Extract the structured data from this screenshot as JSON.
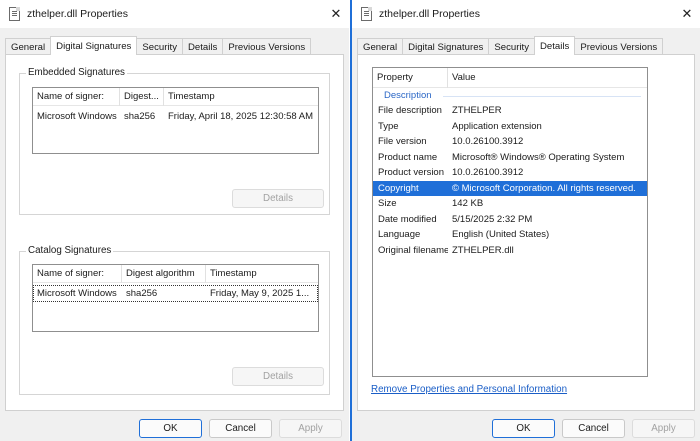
{
  "left_window": {
    "title": "zthelper.dll Properties",
    "close_glyph": "✕",
    "tabs": [
      "General",
      "Digital Signatures",
      "Security",
      "Details",
      "Previous Versions"
    ],
    "active_tab": "Digital Signatures",
    "embedded": {
      "legend": "Embedded Signatures",
      "columns": [
        "Name of signer:",
        "Digest...",
        "Timestamp"
      ],
      "rows": [
        [
          "Microsoft Windows",
          "sha256",
          "Friday, April 18, 2025 12:30:58 AM"
        ]
      ],
      "details_button": "Details"
    },
    "catalog": {
      "legend": "Catalog Signatures",
      "columns": [
        "Name of signer:",
        "Digest algorithm",
        "Timestamp"
      ],
      "rows": [
        [
          "Microsoft Windows",
          "sha256",
          "Friday, May 9, 2025 1..."
        ]
      ],
      "details_button": "Details"
    },
    "buttons": {
      "ok": "OK",
      "cancel": "Cancel",
      "apply": "Apply"
    }
  },
  "right_window": {
    "title": "zthelper.dll Properties",
    "close_glyph": "✕",
    "tabs": [
      "General",
      "Digital Signatures",
      "Security",
      "Details",
      "Previous Versions"
    ],
    "active_tab": "Details",
    "details": {
      "columns": [
        "Property",
        "Value"
      ],
      "section": "Description",
      "rows": [
        [
          "File description",
          "ZTHELPER"
        ],
        [
          "Type",
          "Application extension"
        ],
        [
          "File version",
          "10.0.26100.3912"
        ],
        [
          "Product name",
          "Microsoft® Windows® Operating System"
        ],
        [
          "Product version",
          "10.0.26100.3912"
        ],
        [
          "Copyright",
          "© Microsoft Corporation. All rights reserved."
        ],
        [
          "Size",
          "142 KB"
        ],
        [
          "Date modified",
          "5/15/2025 2:32 PM"
        ],
        [
          "Language",
          "English (United States)"
        ],
        [
          "Original filename",
          "ZTHELPER.dll"
        ]
      ],
      "selected_row": "Copyright"
    },
    "remove_link": "Remove Properties and Personal Information",
    "buttons": {
      "ok": "OK",
      "cancel": "Cancel",
      "apply": "Apply"
    }
  },
  "colors": {
    "accent": "#1f6fd8",
    "link": "#1a5ec7",
    "section": "#2b67c6"
  }
}
